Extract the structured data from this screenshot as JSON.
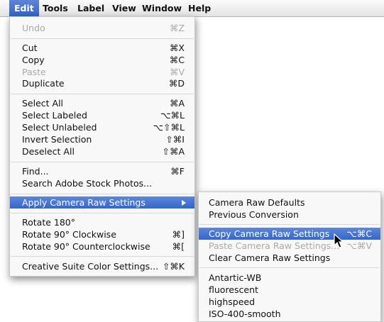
{
  "menubar": {
    "items": [
      {
        "label": "Edit",
        "active": true
      },
      {
        "label": "Tools"
      },
      {
        "label": "Label"
      },
      {
        "label": "View"
      },
      {
        "label": "Window"
      },
      {
        "label": "Help"
      }
    ]
  },
  "edit_menu": {
    "items": [
      {
        "label": "Undo",
        "shortcut": "⌘Z",
        "disabled": true
      },
      {
        "label": "Cut",
        "shortcut": "⌘X"
      },
      {
        "label": "Copy",
        "shortcut": "⌘C"
      },
      {
        "label": "Paste",
        "shortcut": "⌘V",
        "disabled": true
      },
      {
        "label": "Duplicate",
        "shortcut": "⌘D"
      },
      {
        "label": "Select All",
        "shortcut": "⌘A"
      },
      {
        "label": "Select Labeled",
        "shortcut": "⌥⌘L"
      },
      {
        "label": "Select Unlabeled",
        "shortcut": "⌥⇧⌘L"
      },
      {
        "label": "Invert Selection",
        "shortcut": "⇧⌘I"
      },
      {
        "label": "Deselect All",
        "shortcut": "⇧⌘A"
      },
      {
        "label": "Find...",
        "shortcut": "⌘F"
      },
      {
        "label": "Search Adobe Stock Photos...",
        "shortcut": ""
      },
      {
        "label": "Apply Camera Raw Settings",
        "shortcut": "",
        "highlighted": true,
        "submenu": true
      },
      {
        "label": "Rotate 180°",
        "shortcut": ""
      },
      {
        "label": "Rotate 90° Clockwise",
        "shortcut": "⌘]"
      },
      {
        "label": "Rotate 90° Counterclockwise",
        "shortcut": "⌘["
      },
      {
        "label": "Creative Suite Color Settings...",
        "shortcut": "⇧⌘K"
      }
    ]
  },
  "camera_raw_submenu": {
    "items": [
      {
        "label": "Camera Raw Defaults",
        "shortcut": ""
      },
      {
        "label": "Previous Conversion",
        "shortcut": ""
      },
      {
        "label": "Copy Camera Raw Settings",
        "shortcut": "⌥⌘C",
        "highlighted": true
      },
      {
        "label": "Paste Camera Raw Settings...",
        "shortcut": "⌥⌘V",
        "disabled": true
      },
      {
        "label": "Clear Camera Raw Settings",
        "shortcut": ""
      },
      {
        "label": "Antartic-WB",
        "shortcut": ""
      },
      {
        "label": "fluorescent",
        "shortcut": ""
      },
      {
        "label": "highspeed",
        "shortcut": ""
      },
      {
        "label": "ISO-400-smooth",
        "shortcut": ""
      }
    ]
  },
  "colors": {
    "highlight": "#3f6fcf",
    "disabled_text": "#a9a9a9",
    "menu_bg": "#f8f8f8"
  },
  "icons": {
    "submenu_arrow": "triangle-right-icon",
    "pointer": "arrow-cursor-icon"
  }
}
